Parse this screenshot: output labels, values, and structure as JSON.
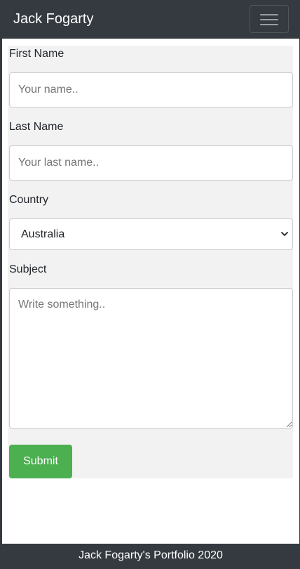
{
  "navbar": {
    "brand": "Jack Fogarty",
    "toggler_icon": "hamburger-menu-icon"
  },
  "form": {
    "first_name": {
      "label": "First Name",
      "placeholder": "Your name.."
    },
    "last_name": {
      "label": "Last Name",
      "placeholder": "Your last name.."
    },
    "country": {
      "label": "Country",
      "selected": "Australia"
    },
    "subject": {
      "label": "Subject",
      "placeholder": "Write something.."
    },
    "submit_label": "Submit"
  },
  "footer": {
    "text": "Jack Fogarty's Portfolio 2020"
  },
  "colors": {
    "navbar_bg": "#343a40",
    "panel_bg": "#f2f2f2",
    "submit_bg": "#4caf50"
  }
}
